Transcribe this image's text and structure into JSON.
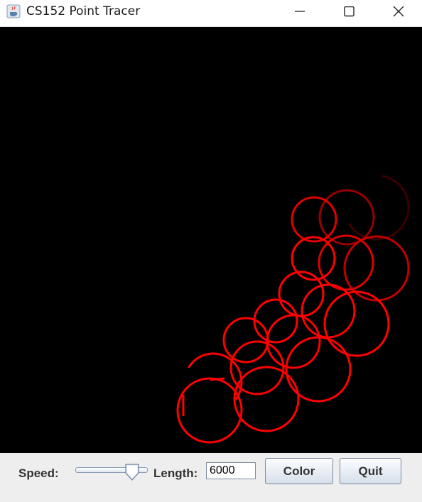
{
  "window": {
    "title": "CS152 Point Tracer",
    "icons": {
      "app": "java-cup-icon",
      "minimize": "minimize-icon",
      "maximize": "maximize-icon",
      "close": "close-icon"
    }
  },
  "canvas": {
    "background": "#000000",
    "trace_colors": [
      "#ff0000",
      "#e00000",
      "#c00000",
      "#990000",
      "#6a0000",
      "#3a0000"
    ]
  },
  "controls": {
    "speed_label": "Speed:",
    "speed_value": 0.85,
    "length_label": "Length:",
    "length_value": "6000",
    "color_button": "Color",
    "quit_button": "Quit"
  }
}
